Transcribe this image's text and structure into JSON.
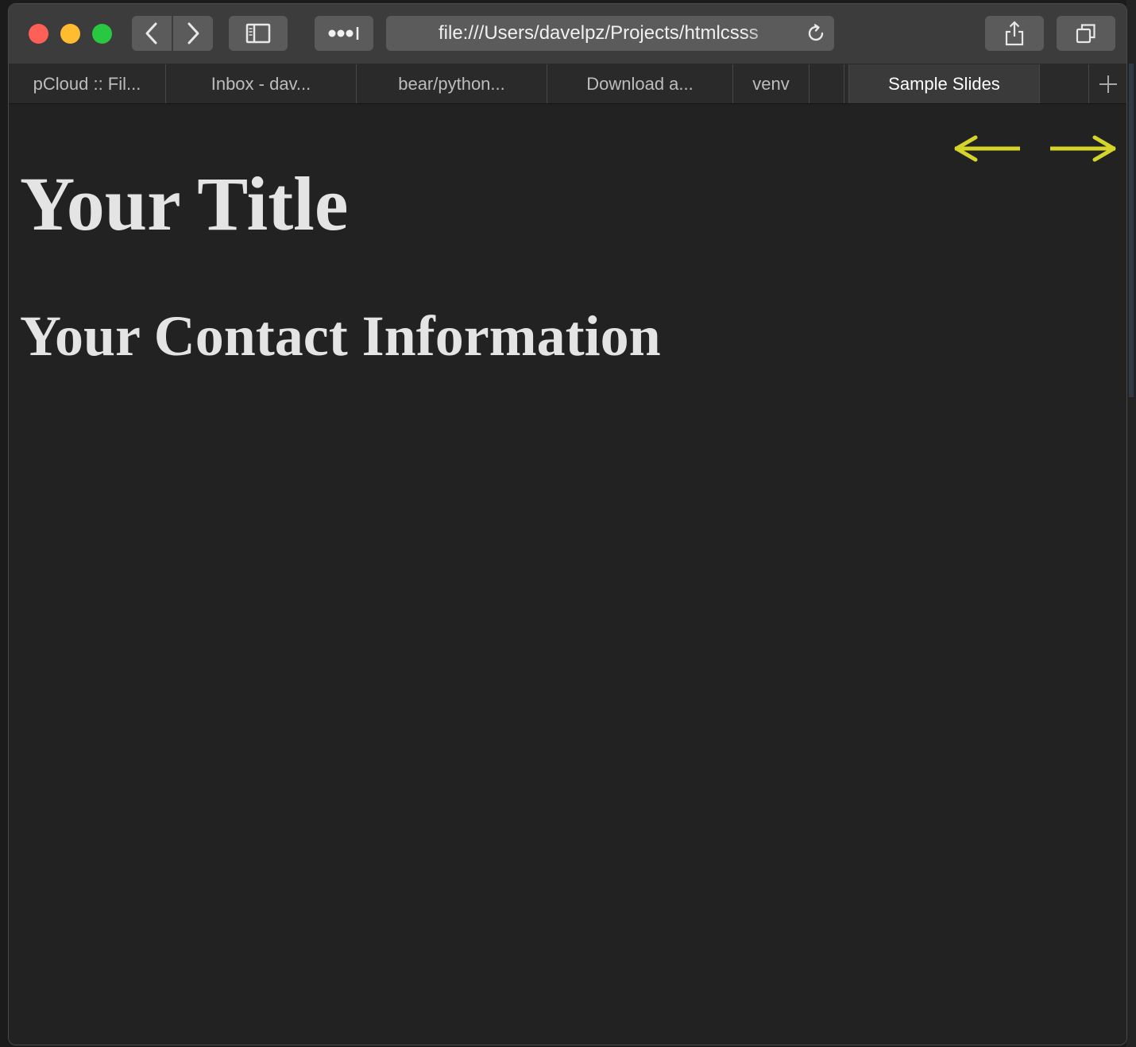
{
  "browser": {
    "url": "file:///Users/davelpz/Projects/htmlcsss",
    "tabs": [
      {
        "label": "pCloud :: Fil..."
      },
      {
        "label": "Inbox - dav..."
      },
      {
        "label": "bear/python..."
      },
      {
        "label": "Download a..."
      },
      {
        "label": "venv"
      },
      {
        "label": ""
      },
      {
        "label": "Sample Slides",
        "active": true
      }
    ]
  },
  "icons": {
    "back": "chevron-left-icon",
    "forward": "chevron-right-icon",
    "sidebar": "sidebar-icon",
    "more": "more-dots-icon",
    "reload": "reload-icon",
    "share": "share-icon",
    "tabs": "tab-overview-icon",
    "new_tab": "plus-icon"
  },
  "slide": {
    "title": "Your Title",
    "subtitle": "Your Contact Information",
    "nav_arrow_color": "#d4d42a"
  }
}
